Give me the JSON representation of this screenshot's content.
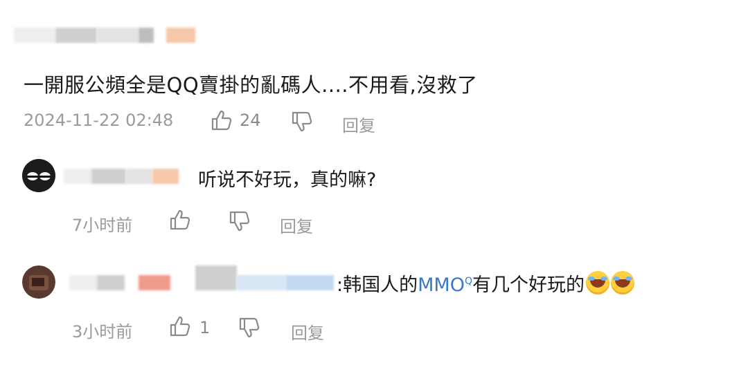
{
  "comment": {
    "text": "一開服公頻全是QQ賣掛的亂碼人....不用看,沒救了",
    "timestamp": "2024-11-22 02:48",
    "like_count": "24",
    "reply_label": "回复"
  },
  "replies": [
    {
      "text": "听说不好玩，真的嘛?",
      "time": "7小时前",
      "like_count": "",
      "reply_label": "回复"
    },
    {
      "prefix": ":韩国人的",
      "link_text": "MMO",
      "link_mark": "Q",
      "suffix": "有几个好玩的",
      "time": "3小时前",
      "like_count": "1",
      "reply_label": "回复"
    }
  ],
  "icons": {
    "like": "thumbs-up-icon",
    "dislike": "thumbs-down-icon",
    "search": "search-icon",
    "emoji": "crying-laughing-emoji"
  },
  "colors": {
    "link": "#3a78c9",
    "meta": "#9a9a9a"
  }
}
